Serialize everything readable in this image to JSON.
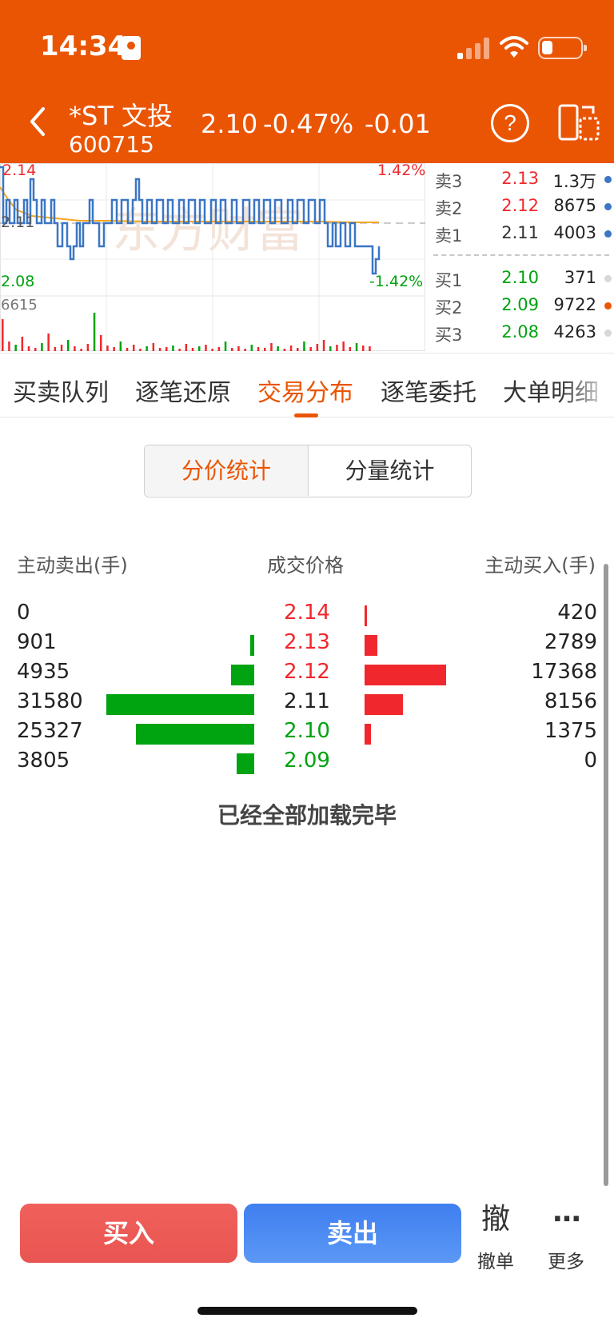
{
  "status_bar": {
    "time": "14:34"
  },
  "header": {
    "name": "*ST 文投",
    "code": "600715",
    "price": "2.10",
    "change_pct": "-0.47%",
    "change": "-0.01",
    "help_glyph": "?",
    "icons": [
      "back-icon",
      "help-icon",
      "landscape-switch-icon"
    ]
  },
  "intraday_chart": {
    "high_price": "2.14",
    "mid_price": "2.11",
    "low_price": "2.08",
    "high_pct": "1.42%",
    "low_pct": "-1.42%",
    "volume_max": "6615",
    "watermark": "东方财富"
  },
  "order_book": {
    "asks": [
      {
        "label": "卖3",
        "price": "2.13",
        "volume": "1.3万"
      },
      {
        "label": "卖2",
        "price": "2.12",
        "volume": "8675"
      },
      {
        "label": "卖1",
        "price": "2.11",
        "volume": "4003"
      }
    ],
    "bids": [
      {
        "label": "买1",
        "price": "2.10",
        "volume": "371"
      },
      {
        "label": "买2",
        "price": "2.09",
        "volume": "9722"
      },
      {
        "label": "买3",
        "price": "2.08",
        "volume": "4263"
      }
    ]
  },
  "tabs": [
    {
      "label": "买卖队列"
    },
    {
      "label": "逐笔还原"
    },
    {
      "label": "交易分布"
    },
    {
      "label": "逐笔委托"
    },
    {
      "label": "大单明细"
    }
  ],
  "active_tab": "交易分布",
  "segment": {
    "by_price": "分价统计",
    "by_volume": "分量统计",
    "selected": "分价统计"
  },
  "distribution": {
    "headers": {
      "sell": "主动卖出(手)",
      "price": "成交价格",
      "buy": "主动买入(手)"
    },
    "rows": [
      {
        "sell": "0",
        "price": "2.14",
        "buy": "420",
        "sell_value": 0,
        "buy_value": 420
      },
      {
        "sell": "901",
        "price": "2.13",
        "buy": "2789",
        "sell_value": 901,
        "buy_value": 2789
      },
      {
        "sell": "4935",
        "price": "2.12",
        "buy": "17368",
        "sell_value": 4935,
        "buy_value": 17368
      },
      {
        "sell": "31580",
        "price": "2.11",
        "buy": "8156",
        "sell_value": 31580,
        "buy_value": 8156
      },
      {
        "sell": "25327",
        "price": "2.10",
        "buy": "1375",
        "sell_value": 25327,
        "buy_value": 1375
      },
      {
        "sell": "3805",
        "price": "2.09",
        "buy": "0",
        "sell_value": 3805,
        "buy_value": 0
      }
    ],
    "footer": "已经全部加载完毕"
  },
  "actions": {
    "buy": "买入",
    "sell": "卖出",
    "cancel_glyph": "撤",
    "cancel": "撤单",
    "more_glyph": "···",
    "more": "更多"
  },
  "colors": {
    "brand": "#ea5504",
    "up": "#f0282d",
    "down": "#00a310",
    "buy_button": "#e95552",
    "sell_button": "#4a88f2"
  }
}
